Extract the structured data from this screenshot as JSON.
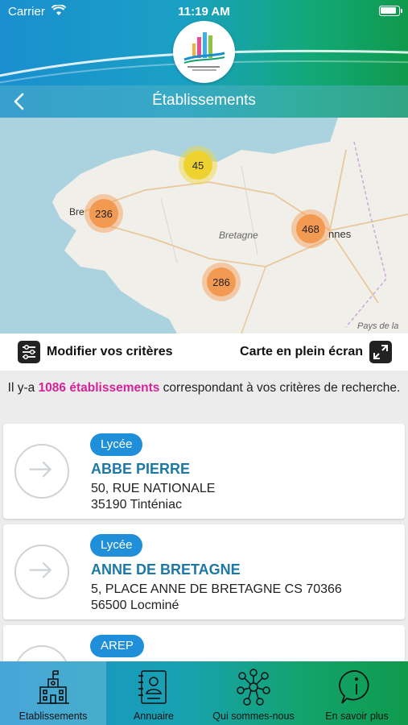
{
  "statusbar": {
    "carrier": "Carrier",
    "time": "11:19 AM"
  },
  "navbar": {
    "title": "Établissements"
  },
  "map": {
    "region_label": "Bretagne",
    "city_brest_fragment": "Bre",
    "city_rennes_fragment": "nnes",
    "attribution_fragment": "Pays de la",
    "clusters": [
      {
        "count": "45",
        "color": "yellow"
      },
      {
        "count": "236",
        "color": "orange"
      },
      {
        "count": "468",
        "color": "orange"
      },
      {
        "count": "286",
        "color": "orange"
      }
    ]
  },
  "criteria": {
    "modify_label": "Modifier vos critères",
    "fullscreen_label": "Carte en plein écran"
  },
  "result": {
    "prefix": "Il y-a ",
    "count_text": "1086 établissements",
    "suffix": " correspondant à vos critères de recherche."
  },
  "cards": [
    {
      "badge": "Lycée",
      "name": "ABBE PIERRE",
      "address1": "50, RUE NATIONALE",
      "address2": "35190 Tinténiac"
    },
    {
      "badge": "Lycée",
      "name": "ANNE DE BRETAGNE",
      "address1": "5, PLACE ANNE DE BRETAGNE CS 70366",
      "address2": "56500 Locminé"
    },
    {
      "badge": "AREP",
      "name": "",
      "address1": "",
      "address2": ""
    }
  ],
  "tabs": [
    {
      "label": "Etablissements",
      "icon": "school-building-icon",
      "active": true
    },
    {
      "label": "Annuaire",
      "icon": "contact-book-icon",
      "active": false
    },
    {
      "label": "Qui sommes-nous",
      "icon": "network-people-icon",
      "active": false
    },
    {
      "label": "En savoir plus",
      "icon": "info-bubble-icon",
      "active": false
    }
  ],
  "colors": {
    "accent_pink": "#d6239b",
    "link_blue": "#1d78a8",
    "badge_blue": "#1e8fd8",
    "cluster_orange": "#f39a52",
    "cluster_yellow": "#eed22f"
  }
}
